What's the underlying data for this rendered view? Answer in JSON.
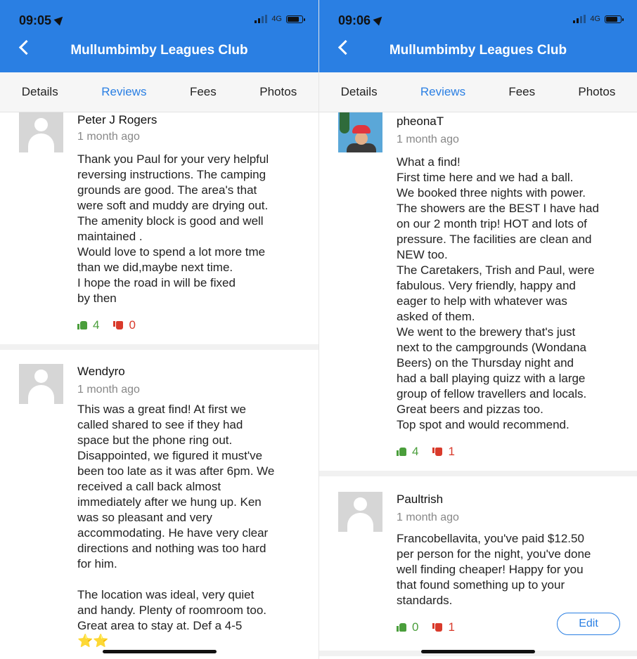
{
  "left": {
    "status_time": "09:05",
    "network": "4G",
    "title": "Mullumbimby Leagues Club",
    "tabs": [
      "Details",
      "Reviews",
      "Fees",
      "Photos"
    ],
    "reviews": [
      {
        "name": "Peter J Rogers",
        "time": "1 month ago",
        "text": "Thank you Paul for your very helpful\nreversing instructions. The camping\ngrounds are good. The area's that\nwere soft and muddy are drying out.\nThe amenity block is good and well\nmaintained .\nWould love to spend a lot more tme\nthan we did,maybe next time.\nI hope the road in will be fixed\nby then",
        "up": "4",
        "down": "0"
      },
      {
        "name": "Wendyro",
        "time": "1 month ago",
        "text": "This was a great find! At first we\ncalled shared to see if they had\nspace but the phone ring out.\nDisappointed, we figured it must've\nbeen too late as it was after 6pm. We\nreceived a call back almost\nimmediately after we hung up. Ken\nwas so pleasant and very\naccommodating. He have very clear\ndirections and nothing was too hard\nfor him.\n\nThe location was ideal, very quiet\nand handy. Plenty of roomroom too.\nGreat area to stay at. Def a 4-5",
        "stars": "⭐⭐"
      }
    ]
  },
  "right": {
    "status_time": "09:06",
    "network": "4G",
    "title": "Mullumbimby Leagues Club",
    "tabs": [
      "Details",
      "Reviews",
      "Fees",
      "Photos"
    ],
    "reviews": [
      {
        "name": "pheonaT",
        "time": "1 month ago",
        "text": "What a find!\nFirst time here and we had a ball.\nWe booked three nights with power.\nThe showers are the BEST I have had\non our 2 month trip!  HOT and lots of\npressure.  The facilities are clean and\nNEW too.\nThe Caretakers, Trish and Paul, were\nfabulous.  Very friendly, happy and\neager to help with whatever was\nasked of them.\nWe went to the brewery that's just\nnext to the campgrounds (Wondana\nBeers) on the Thursday night and\nhad a ball playing quizz with a large\ngroup of fellow travellers and locals.\nGreat beers and pizzas too.\nTop spot and would recommend.",
        "up": "4",
        "down": "1"
      },
      {
        "name": "Paultrish",
        "time": "1 month ago",
        "text": "Francobellavita, you've paid $12.50\nper person for the night, you've done\nwell finding cheaper! Happy for you\nthat found something up to your\nstandards.",
        "up": "0",
        "down": "1",
        "edit_label": "Edit"
      }
    ]
  }
}
